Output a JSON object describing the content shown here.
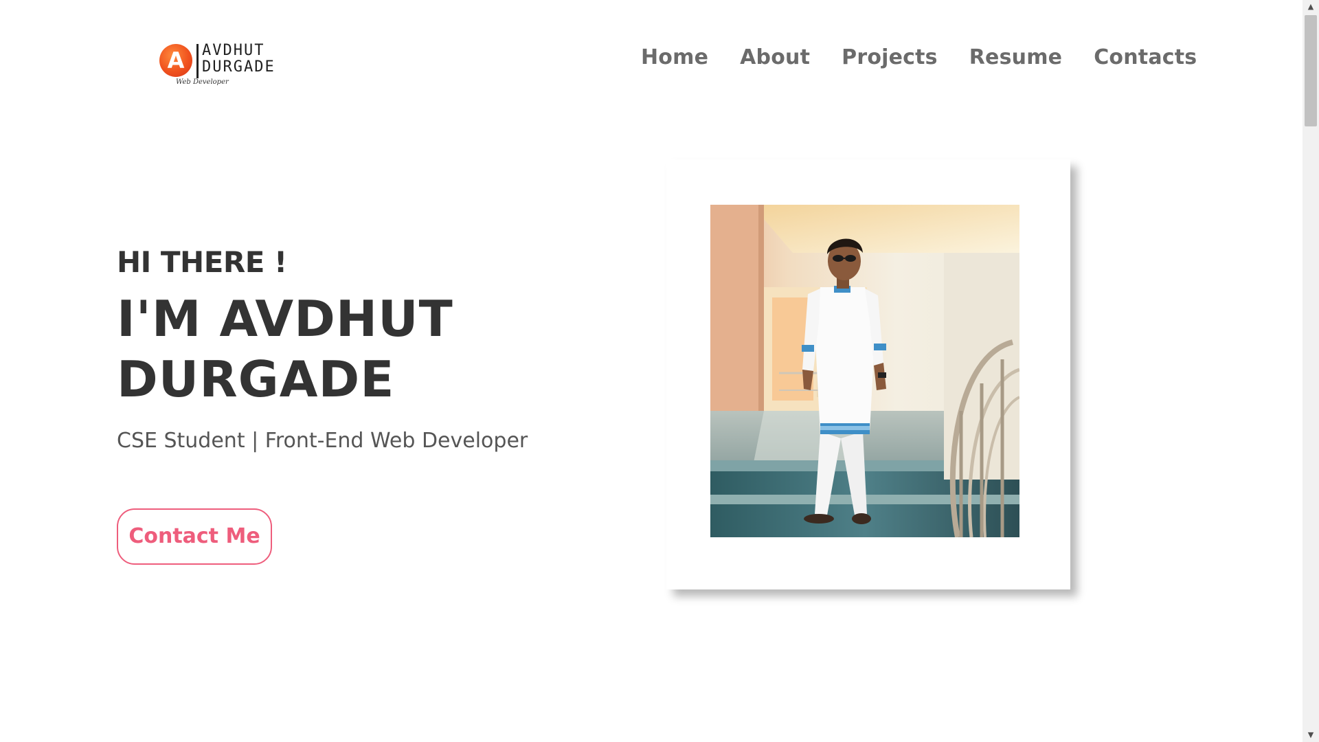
{
  "logo": {
    "initial": "A",
    "name_line1": "AVDHUT",
    "name_line2": "DURGADE",
    "tagline": "Web Developer"
  },
  "nav": {
    "items": [
      {
        "label": "Home"
      },
      {
        "label": "About"
      },
      {
        "label": "Projects"
      },
      {
        "label": "Resume"
      },
      {
        "label": "Contacts"
      }
    ]
  },
  "hero": {
    "greeting": "HI THERE !",
    "name_line1": "I'M AVDHUT",
    "name_line2": "DURGADE",
    "subtitle": "CSE Student | Front-End Web Developer",
    "cta_label": "Contact Me"
  },
  "colors": {
    "accent": "#ee5d7c",
    "logo_orange": "#f0521e",
    "heading": "#333333",
    "nav_text": "#6b6b6b"
  },
  "icons": {
    "scroll_up": "triangle-up-icon",
    "scroll_down": "triangle-down-icon"
  }
}
